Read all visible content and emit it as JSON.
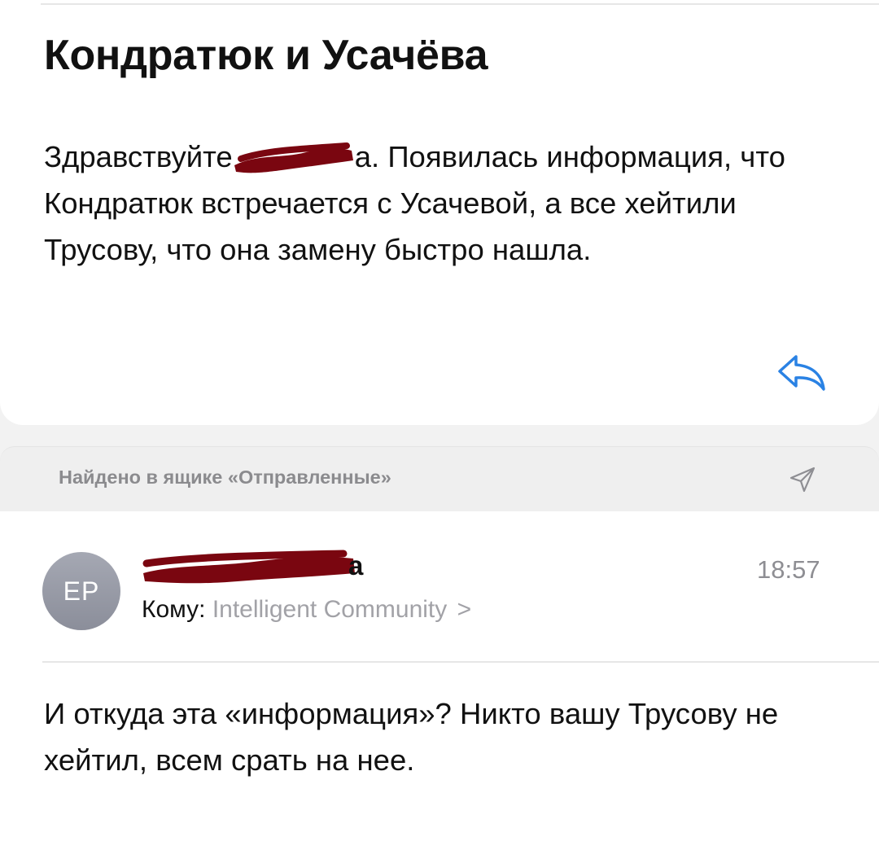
{
  "first_message": {
    "subject": "Кондратюк и Усачёва",
    "greeting_prefix": "Здравствуйте",
    "greeting_suffix": "а. Появилась информация, что Кондратюк встречается с Усачевой, а все хейтили Трусову, что она замену быстро нашла.",
    "reply_icon": "reply-arrow-icon",
    "redaction_color": "#7a0610"
  },
  "found_bar": {
    "text": "Найдено в ящике «Отправленные»",
    "icon": "paper-plane-icon"
  },
  "second_message": {
    "avatar_initials": "EP",
    "sender_visible_tail": "а",
    "time": "18:57",
    "to_label": "Кому:",
    "to_value": "Intelligent Community",
    "to_chevron": ">",
    "body": "И откуда эта «информация»? Никто вашу Трусову не хейтил, всем срать на нее."
  },
  "colors": {
    "accent_blue": "#2a82e4",
    "secondary_gray": "#8e8e93",
    "background_gray": "#f2f2f2"
  }
}
